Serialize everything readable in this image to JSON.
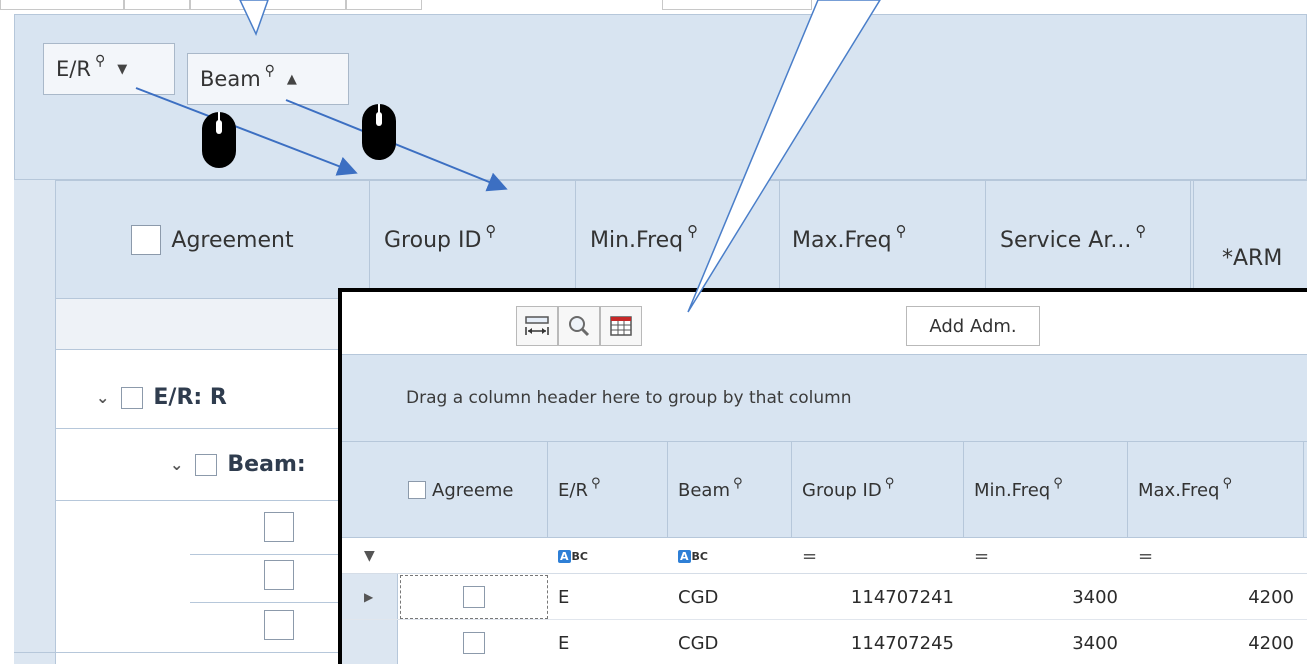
{
  "background_grid": {
    "group_chips": [
      {
        "label": "E/R",
        "sort": "desc"
      },
      {
        "label": "Beam",
        "sort": "asc"
      }
    ],
    "headers": [
      "Agreement",
      "Group ID",
      "Min.Freq",
      "Max.Freq",
      "Service Ar...",
      "*ARM"
    ],
    "group_rows": [
      "E/R: R",
      "Beam: "
    ]
  },
  "overlay_grid": {
    "add_button": "Add Adm.",
    "group_panel_hint": "Drag a column header here to group by that column",
    "headers": [
      "Agreeme",
      "E/R",
      "Beam",
      "Group ID",
      "Min.Freq",
      "Max.Freq"
    ],
    "filter_row": {
      "text_filter_icon": "abc-icon",
      "equals_symbol": "="
    },
    "rows": [
      {
        "er": "E",
        "beam": "CGD",
        "group_id": "114707241",
        "min_freq": "3400",
        "max_freq": "4200"
      },
      {
        "er": "E",
        "beam": "CGD",
        "group_id": "114707245",
        "min_freq": "3400",
        "max_freq": "4200"
      }
    ]
  },
  "icons": {
    "filter_pin": "filter-icon",
    "mouse_drag_cursor": "mouse-icon",
    "best_fit": "column-fit-icon",
    "search": "search-icon",
    "column_chooser": "column-chooser-icon"
  },
  "colors": {
    "header_blue": "#d8e4f1",
    "grid_line": "#b6c7da",
    "callout_line": "#4a7ec9",
    "arrow": "#3c6fc2"
  }
}
